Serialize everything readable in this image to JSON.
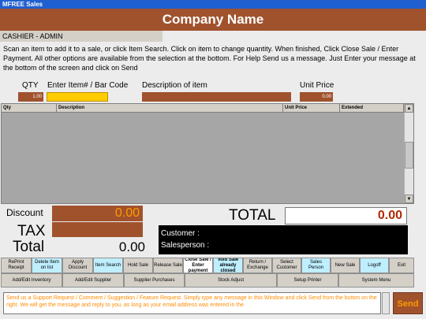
{
  "window": {
    "title": "MFREE Sales"
  },
  "header": {
    "company": "Company Name",
    "cashier": "CASHIER - ADMIN"
  },
  "instructions": "Scan an item to add it to a sale, or click Item Search. Click on item to change quantity. When finished, Click Close Sale / Enter Payment. All other options are available from the selection at the bottom. For Help Send us a message. Just Enter your message at the bottom of the screen and click on Send",
  "entry": {
    "qty_label": "QTY",
    "item_label": "Enter Item# / Bar Code",
    "desc_label": "Description of item",
    "price_label": "Unit Price",
    "qty_value": "1.00",
    "item_value": "",
    "desc_value": "",
    "price_value": "0.00"
  },
  "grid": {
    "columns": [
      "Qty",
      "Description",
      "Unit Price",
      "Extended"
    ]
  },
  "totals": {
    "discount_label": "Discount",
    "discount_value": "0.00",
    "tax_label": "TAX",
    "tax_value": "",
    "total_label": "Total",
    "total_value": "0.00",
    "grand_label": "TOTAL",
    "grand_value": "0.00",
    "customer_label": "Customer :",
    "salesperson_label": "Salesperson :"
  },
  "buttons_row1": [
    {
      "label": "RePrint Receipt",
      "style": ""
    },
    {
      "label": "Delete Item on list",
      "style": "cyan"
    },
    {
      "label": "Apply Discount",
      "style": ""
    },
    {
      "label": "Item Search",
      "style": "cyan"
    },
    {
      "label": "Hold Sale",
      "style": ""
    },
    {
      "label": "Release Sale",
      "style": ""
    },
    {
      "label": "Close Sale / Enter payment",
      "style": "white bold"
    },
    {
      "label": "Void Sale already closed",
      "style": "cyan bold"
    },
    {
      "label": "Return / Exchange",
      "style": ""
    },
    {
      "label": "Select Customer",
      "style": ""
    },
    {
      "label": "Sales Person",
      "style": "cyan"
    },
    {
      "label": "New Sale",
      "style": ""
    },
    {
      "label": "Logoff",
      "style": "cyan"
    },
    {
      "label": "Exit",
      "style": ""
    }
  ],
  "buttons_row2": [
    {
      "label": "Add/Edit Inventory"
    },
    {
      "label": "Add/Edit Supplier"
    },
    {
      "label": "Supplier Purchases"
    },
    {
      "label": "Stock Adjust"
    },
    {
      "label": "Setup Printer"
    },
    {
      "label": "System Menu"
    }
  ],
  "message": {
    "text": "Send us a Support Request / Comment / Suggestion / Feature Request. Simply type any message in this Window and click Send from the button on the right. We will get the message and reply to you, as long as your email address was entered in the",
    "send_label": "Send"
  },
  "colors": {
    "accent": "#a0522d",
    "orange_text": "#ff9a00",
    "titlebar": "#1f5fcf"
  }
}
